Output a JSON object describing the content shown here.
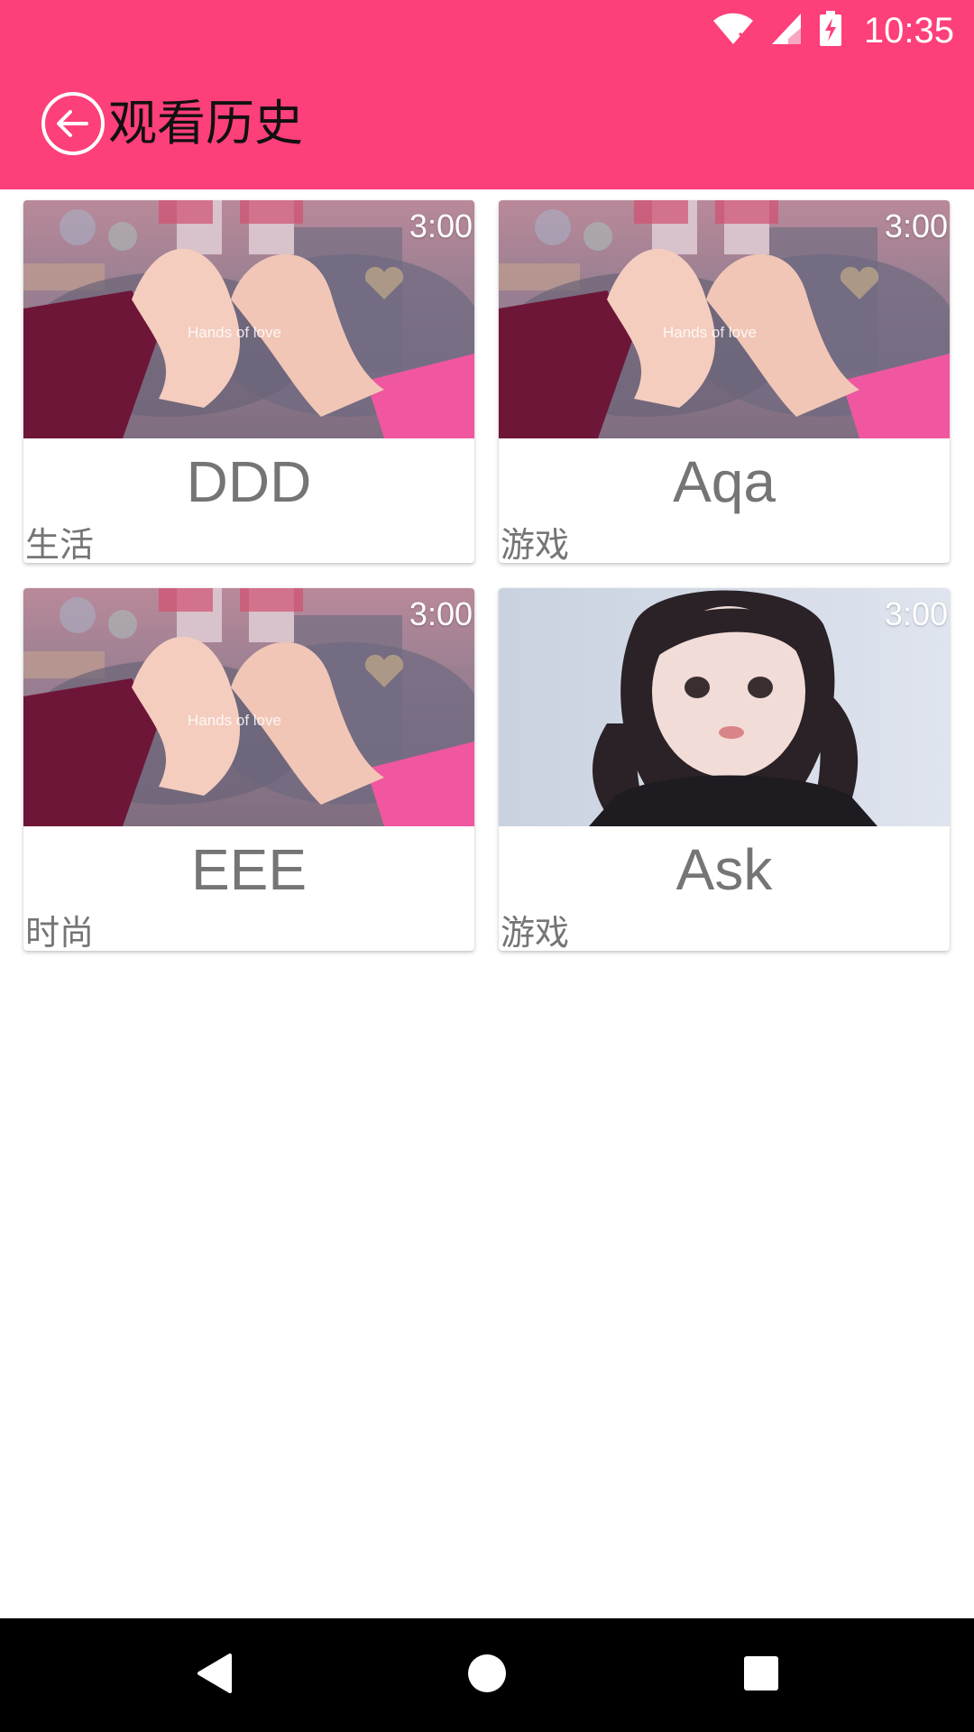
{
  "status_bar": {
    "time": "10:35",
    "icons": [
      "wifi-icon",
      "cell-signal-icon",
      "battery-charging-icon"
    ]
  },
  "app_bar": {
    "title": "观看历史",
    "back_icon": "back-arrow-circle-icon",
    "color": "#fd3f7a"
  },
  "history": {
    "items": [
      {
        "title": "DDD",
        "category": "生活",
        "duration": "3:00",
        "thumbnail": "heart-hands-photo"
      },
      {
        "title": "Aqa",
        "category": "游戏",
        "duration": "3:00",
        "thumbnail": "heart-hands-photo"
      },
      {
        "title": "EEE",
        "category": "时尚",
        "duration": "3:00",
        "thumbnail": "heart-hands-photo"
      },
      {
        "title": "Ask",
        "category": "游戏",
        "duration": "3:00",
        "thumbnail": "girl-portrait-photo"
      }
    ]
  },
  "thumbnail_watermark": "Hands of love",
  "nav_bar": {
    "icons": [
      "back-triangle-icon",
      "home-circle-icon",
      "recents-square-icon"
    ]
  }
}
